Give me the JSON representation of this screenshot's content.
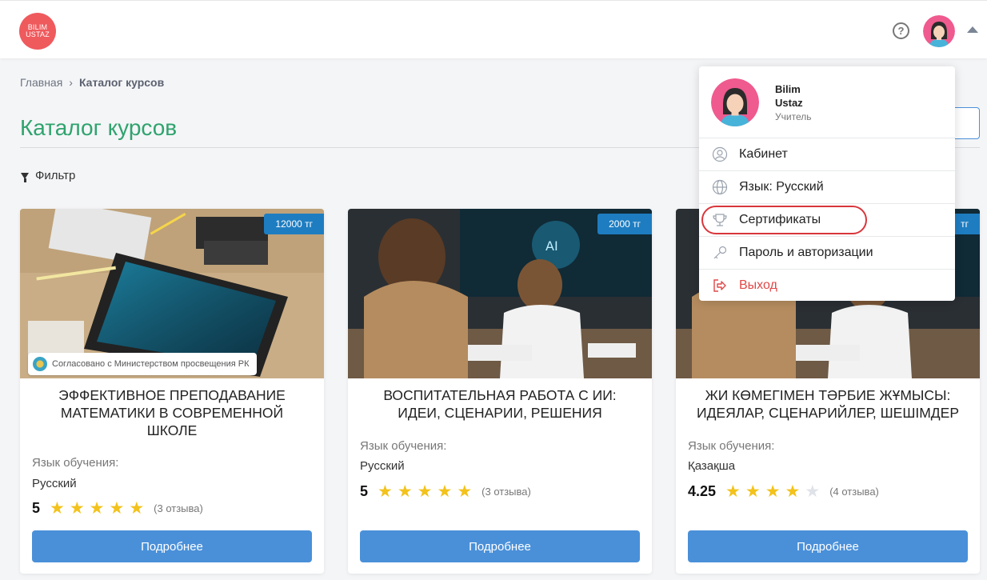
{
  "header": {
    "logo_line1": "BILIM",
    "logo_line2": "USTAZ",
    "help_glyph": "?"
  },
  "breadcrumb": {
    "home": "Главная",
    "separator": "›",
    "current": "Каталог курсов"
  },
  "page_title": "Каталог курсов",
  "filter_label": "Фильтр",
  "cards": [
    {
      "price": "12000 тг",
      "badge": "Согласовано с Министерством просвещения РК",
      "title": "ЭФФЕКТИВНОЕ ПРЕПОДАВАНИЕ МАТЕМАТИКИ В СОВРЕМЕННОЙ ШКОЛЕ",
      "lang_label": "Язык обучения:",
      "lang_value": "Русский",
      "rating": "5",
      "stars_filled": 5,
      "reviews": "(3 отзыва)",
      "button": "Подробнее"
    },
    {
      "price": "2000 тг",
      "title": "ВОСПИТАТЕЛЬНАЯ РАБОТА С ИИ: ИДЕИ, СЦЕНАРИИ, РЕШЕНИЯ",
      "lang_label": "Язык обучения:",
      "lang_value": "Русский",
      "rating": "5",
      "stars_filled": 5,
      "reviews": "(3 отзыва)",
      "button": "Подробнее"
    },
    {
      "price": "тг",
      "title": "ЖИ КӨМЕГІМЕН ТӘРБИЕ ЖҰМЫСЫ: ИДЕЯЛАР, СЦЕНАРИЙЛЕР, ШЕШІМДЕР",
      "lang_label": "Язык обучения:",
      "lang_value": "Қазақша",
      "rating": "4.25",
      "stars_filled": 4,
      "reviews": "(4 отзыва)",
      "button": "Подробнее"
    }
  ],
  "dropdown": {
    "name": "Bilim Ustaz",
    "role": "Учитель",
    "items": [
      {
        "label": "Кабинет",
        "icon": "user-circle-icon"
      },
      {
        "label": "Язык: Русский",
        "icon": "globe-icon"
      },
      {
        "label": "Сертификаты",
        "icon": "trophy-icon"
      },
      {
        "label": "Пароль и авторизации",
        "icon": "key-icon"
      },
      {
        "label": "Выход",
        "icon": "logout-icon"
      }
    ]
  },
  "colors": {
    "accent_green": "#2fa36e",
    "button_blue": "#4a90d9",
    "price_blue": "#1e7dc1",
    "star_gold": "#f3c21b",
    "logout_red": "#e04848",
    "logo_red": "#ef5a5d"
  }
}
